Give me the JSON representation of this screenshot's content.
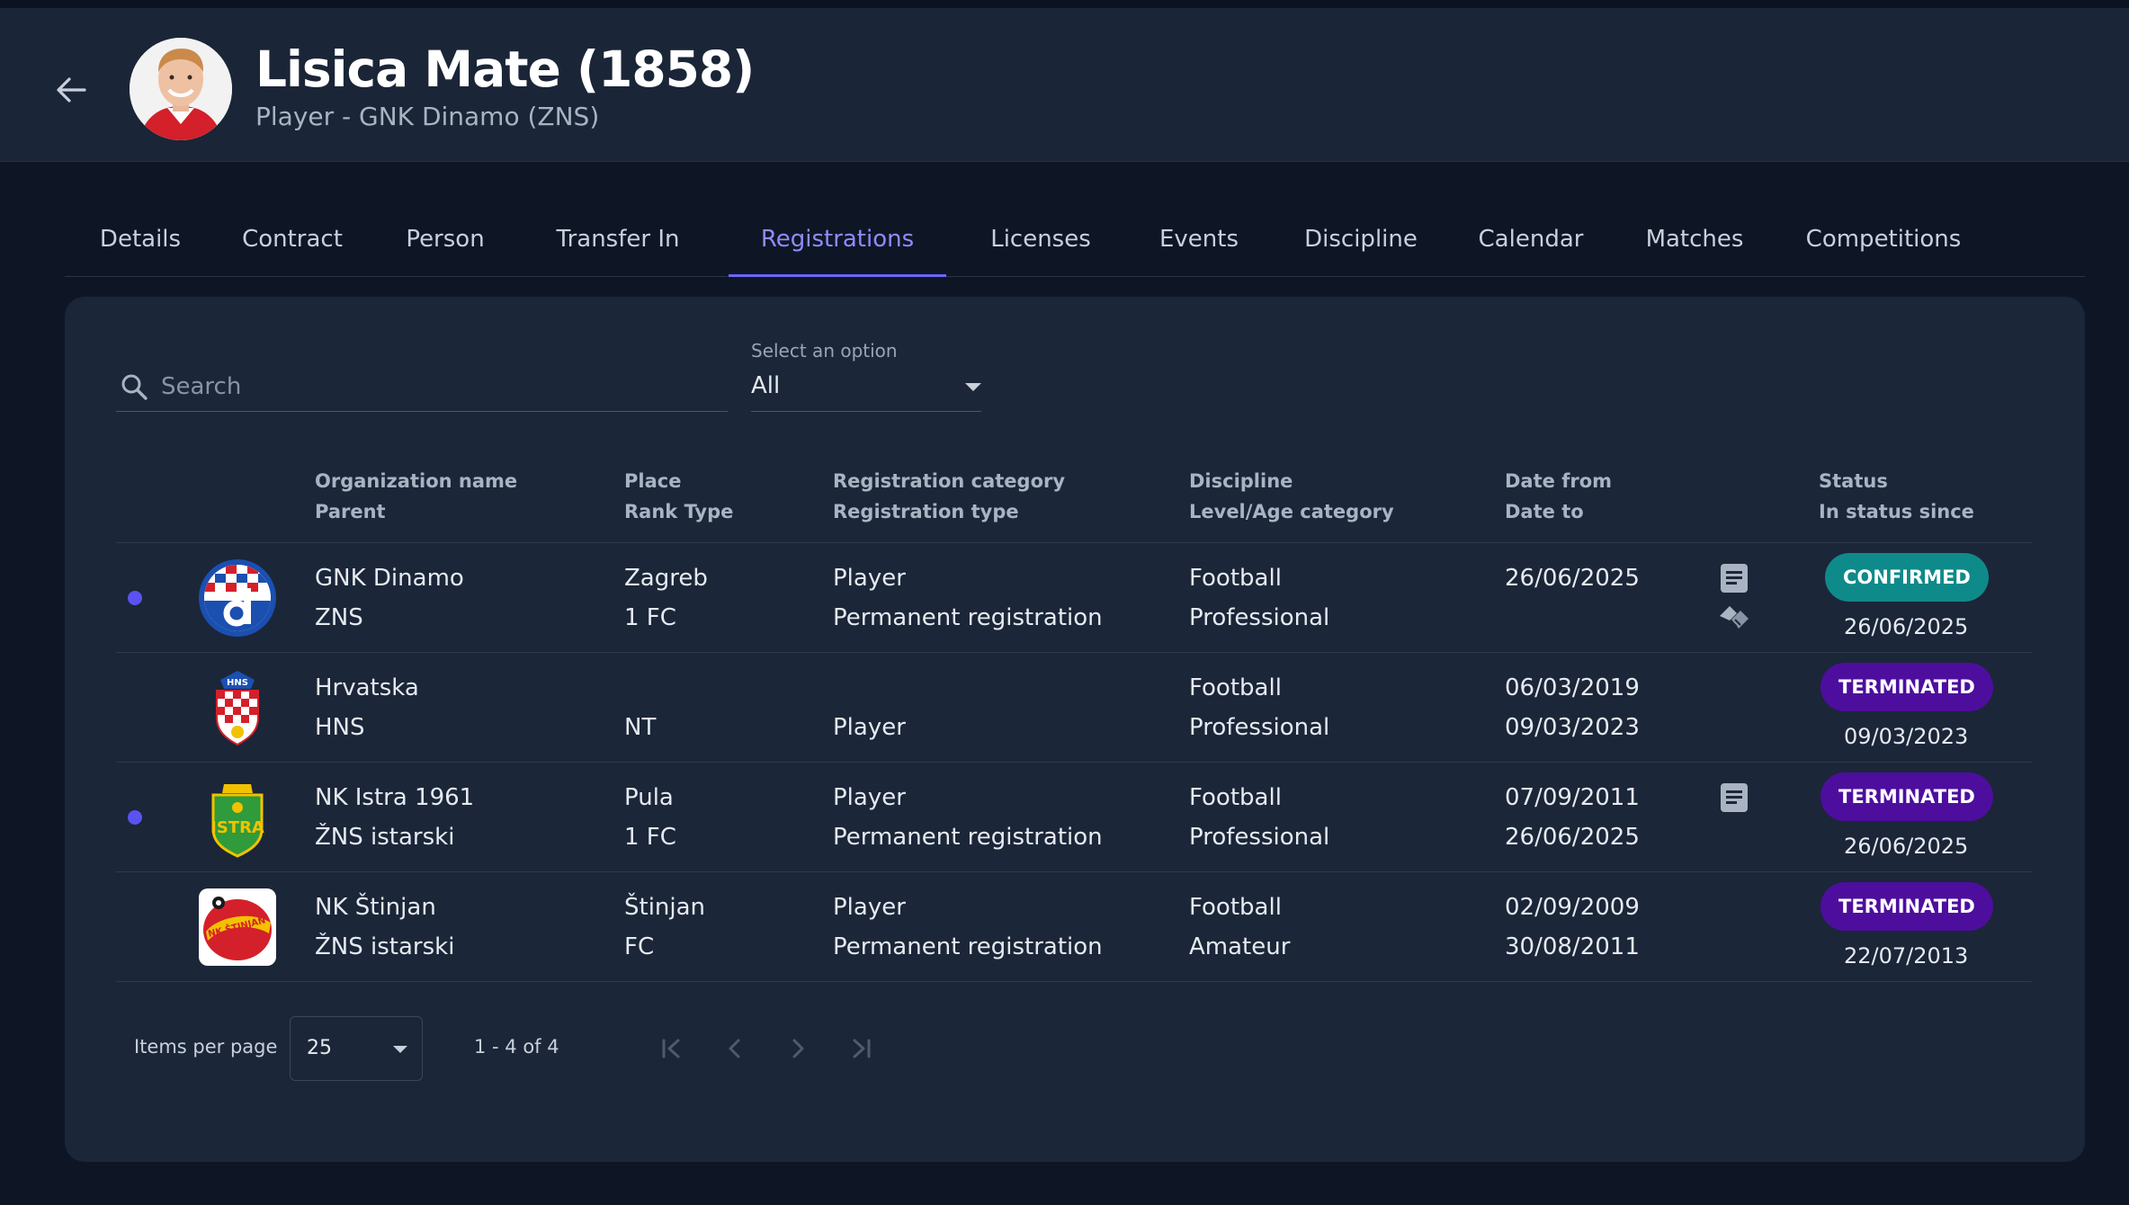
{
  "header": {
    "title": "Lisica Mate (1858)",
    "subtitle": "Player - GNK Dinamo (ZNS)"
  },
  "tabs": [
    {
      "label": "Details"
    },
    {
      "label": "Contract"
    },
    {
      "label": "Person"
    },
    {
      "label": "Transfer In"
    },
    {
      "label": "Registrations",
      "active": true
    },
    {
      "label": "Licenses"
    },
    {
      "label": "Events"
    },
    {
      "label": "Discipline"
    },
    {
      "label": "Calendar"
    },
    {
      "label": "Matches"
    },
    {
      "label": "Competitions"
    }
  ],
  "filters": {
    "search_placeholder": "Search",
    "select_label": "Select an option",
    "select_value": "All"
  },
  "table": {
    "headers": {
      "org": [
        "Organization name",
        "Parent"
      ],
      "place": [
        "Place",
        "Rank Type"
      ],
      "category": [
        "Registration category",
        "Registration type"
      ],
      "discipline": [
        "Discipline",
        "Level/Age category"
      ],
      "dates": [
        "Date from",
        "Date to"
      ],
      "status": [
        "Status",
        "In status since"
      ]
    },
    "rows": [
      {
        "org": "GNK Dinamo",
        "parent": "ZNS",
        "place": "Zagreb",
        "rank": "1 FC",
        "category": "Player",
        "type": "Permanent registration",
        "discipline": "Football",
        "level": "Professional",
        "date_from": "26/06/2025",
        "date_to": "",
        "status": "CONFIRMED",
        "since": "26/06/2025",
        "logo": "dinamo-logo",
        "has_dot": true,
        "icons": [
          "document-icon",
          "handshake-icon"
        ]
      },
      {
        "org": "Hrvatska",
        "parent": "HNS",
        "place": "",
        "rank": "NT",
        "category": "",
        "type": "Player",
        "discipline": "Football",
        "level": "Professional",
        "date_from": "06/03/2019",
        "date_to": "09/03/2023",
        "status": "TERMINATED",
        "since": "09/03/2023",
        "logo": "hns-logo",
        "has_dot": false,
        "icons": []
      },
      {
        "org": "NK Istra 1961",
        "parent": "ŽNS istarski",
        "place": "Pula",
        "rank": "1 FC",
        "category": "Player",
        "type": "Permanent registration",
        "discipline": "Football",
        "level": "Professional",
        "date_from": "07/09/2011",
        "date_to": "26/06/2025",
        "status": "TERMINATED",
        "since": "26/06/2025",
        "logo": "istra-logo",
        "has_dot": true,
        "icons": [
          "document-icon"
        ]
      },
      {
        "org": "NK Štinjan",
        "parent": "ŽNS istarski",
        "place": "Štinjan",
        "rank": "FC",
        "category": "Player",
        "type": "Permanent registration",
        "discipline": "Football",
        "level": "Amateur",
        "date_from": "02/09/2009",
        "date_to": "30/08/2011",
        "status": "TERMINATED",
        "since": "22/07/2013",
        "logo": "stinjan-logo",
        "has_dot": false,
        "icons": []
      }
    ]
  },
  "pagination": {
    "items_per_page_label": "Items per page",
    "items_per_page": "25",
    "range": "1 - 4 of 4"
  },
  "colors": {
    "accent": "#6e66ff",
    "confirmed": "#0f8a8a",
    "terminated": "#4d0e9e",
    "background": "#0e1626",
    "card": "#1b2638"
  }
}
